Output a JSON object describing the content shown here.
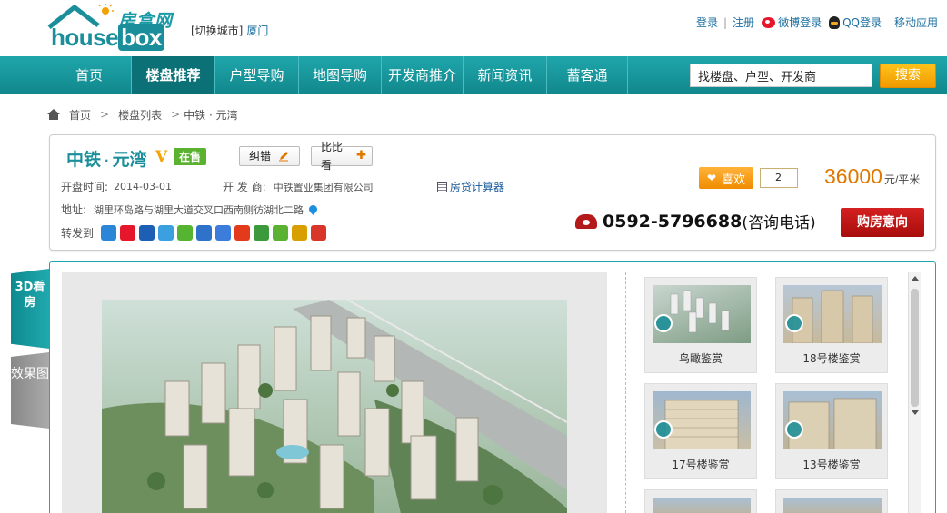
{
  "header": {
    "logo_cn": "房盒网",
    "logo_en_1": "house",
    "logo_en_2": "box",
    "switch_city": "[切换城市]",
    "current_city": "厦门",
    "links": {
      "login": "登录",
      "register": "注册",
      "weibo_login": "微博登录",
      "qq_login": "QQ登录",
      "mobile": "移动应用"
    }
  },
  "nav": {
    "items": [
      {
        "label": "首页"
      },
      {
        "label": "楼盘推荐"
      },
      {
        "label": "户型导购"
      },
      {
        "label": "地图导购"
      },
      {
        "label": "开发商推介"
      },
      {
        "label": "新闻资讯"
      },
      {
        "label": "蓄客通"
      }
    ],
    "active_index": 1,
    "search_value": "找楼盘、户型、开发商",
    "search_button": "搜索"
  },
  "breadcrumb": {
    "home": "首页",
    "list": "楼盘列表",
    "current": "中铁 · 元湾"
  },
  "project": {
    "name_1": "中铁",
    "dot": "·",
    "name_2": "元湾",
    "v_badge": "V",
    "status": "在售",
    "correct_btn": "纠错",
    "compare_btn": "比比看",
    "open_date_label": "开盘时间:",
    "open_date": "2014-03-01",
    "developer_label": "开 发 商:",
    "developer": "中铁置业集团有限公司",
    "calculator": "房贷计算器",
    "address_label": "地址:",
    "address": "湖里环岛路与湖里大道交叉口西南侧彷湖北二路",
    "share_label": "转发到",
    "like_label": "喜欢",
    "like_count": "2",
    "price": "36000",
    "price_unit": "元/平米",
    "phone": "0592-5796688",
    "phone_note": "(咨询电话)",
    "buy_btn": "购房意向"
  },
  "gallery": {
    "tab_3d": "3D看房",
    "tab_effect": "效果图",
    "thumbs": [
      {
        "label": "鸟瞰鉴赏"
      },
      {
        "label": "18号楼鉴赏"
      },
      {
        "label": "17号楼鉴赏"
      },
      {
        "label": "13号楼鉴赏"
      }
    ]
  },
  "colors": {
    "brand": "#1a9aa6",
    "accent": "#f09a00",
    "price": "#e07800",
    "buy": "#c01515"
  }
}
